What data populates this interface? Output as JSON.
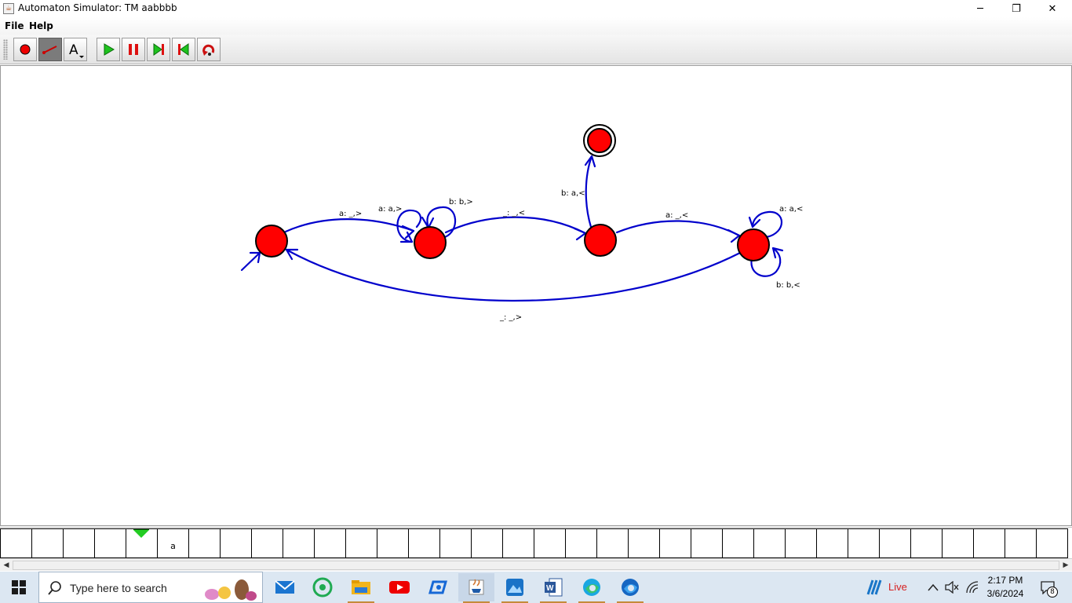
{
  "window": {
    "title": "Automaton Simulator: TM aabbbb",
    "minimize_glyph": "─",
    "maximize_glyph": "❐",
    "close_glyph": "✕"
  },
  "menu": {
    "items": [
      "File",
      "Help"
    ]
  },
  "toolbar": {
    "tools": [
      {
        "name": "state-tool-icon"
      },
      {
        "name": "transition-tool-icon",
        "active": true
      },
      {
        "name": "text-tool-icon",
        "glyph": "A"
      },
      {
        "name": "play-icon"
      },
      {
        "name": "pause-icon"
      },
      {
        "name": "step-forward-icon"
      },
      {
        "name": "step-back-icon"
      },
      {
        "name": "reset-icon"
      }
    ]
  },
  "automaton": {
    "colors": {
      "state_fill": "#ff0000",
      "edge": "#0000cc"
    },
    "edge_labels": {
      "q0_q1": "a: _,>",
      "q1_loop_a": "a: a,>",
      "q1_loop_b": "b: b,>",
      "q1_q2": "_: _,<",
      "q2_q4": "b: a,<",
      "q2_q3": "a: _,<",
      "q3_loop_a": "a: a,<",
      "q3_loop_b": "b: b,<",
      "q3_q0": "_: _,>"
    }
  },
  "tape": {
    "cells": [
      "",
      "",
      "",
      "",
      "",
      "a",
      "",
      "",
      "",
      "",
      "",
      "",
      "",
      "",
      "",
      "",
      "",
      "",
      "",
      "",
      "",
      "",
      "",
      "",
      "",
      "",
      "",
      "",
      "",
      "",
      "",
      "",
      "",
      ""
    ],
    "head_index": 4,
    "head_color": "#22cc22"
  },
  "scrollbar": {
    "left_arrow": "◀",
    "right_arrow": "▶"
  },
  "taskbar": {
    "search_placeholder": "Type here to search",
    "apps": [
      "mail-app-icon",
      "whatsapp-app-icon",
      "file-explorer-app-icon",
      "youtube-app-icon",
      "meet-app-icon",
      "java-app-icon",
      "photos-app-icon",
      "word-app-icon",
      "edge-app-icon",
      "edge-beta-app-icon"
    ],
    "live_label": "Live",
    "time": "2:17 PM",
    "date": "3/6/2024",
    "notification_count": "8"
  }
}
